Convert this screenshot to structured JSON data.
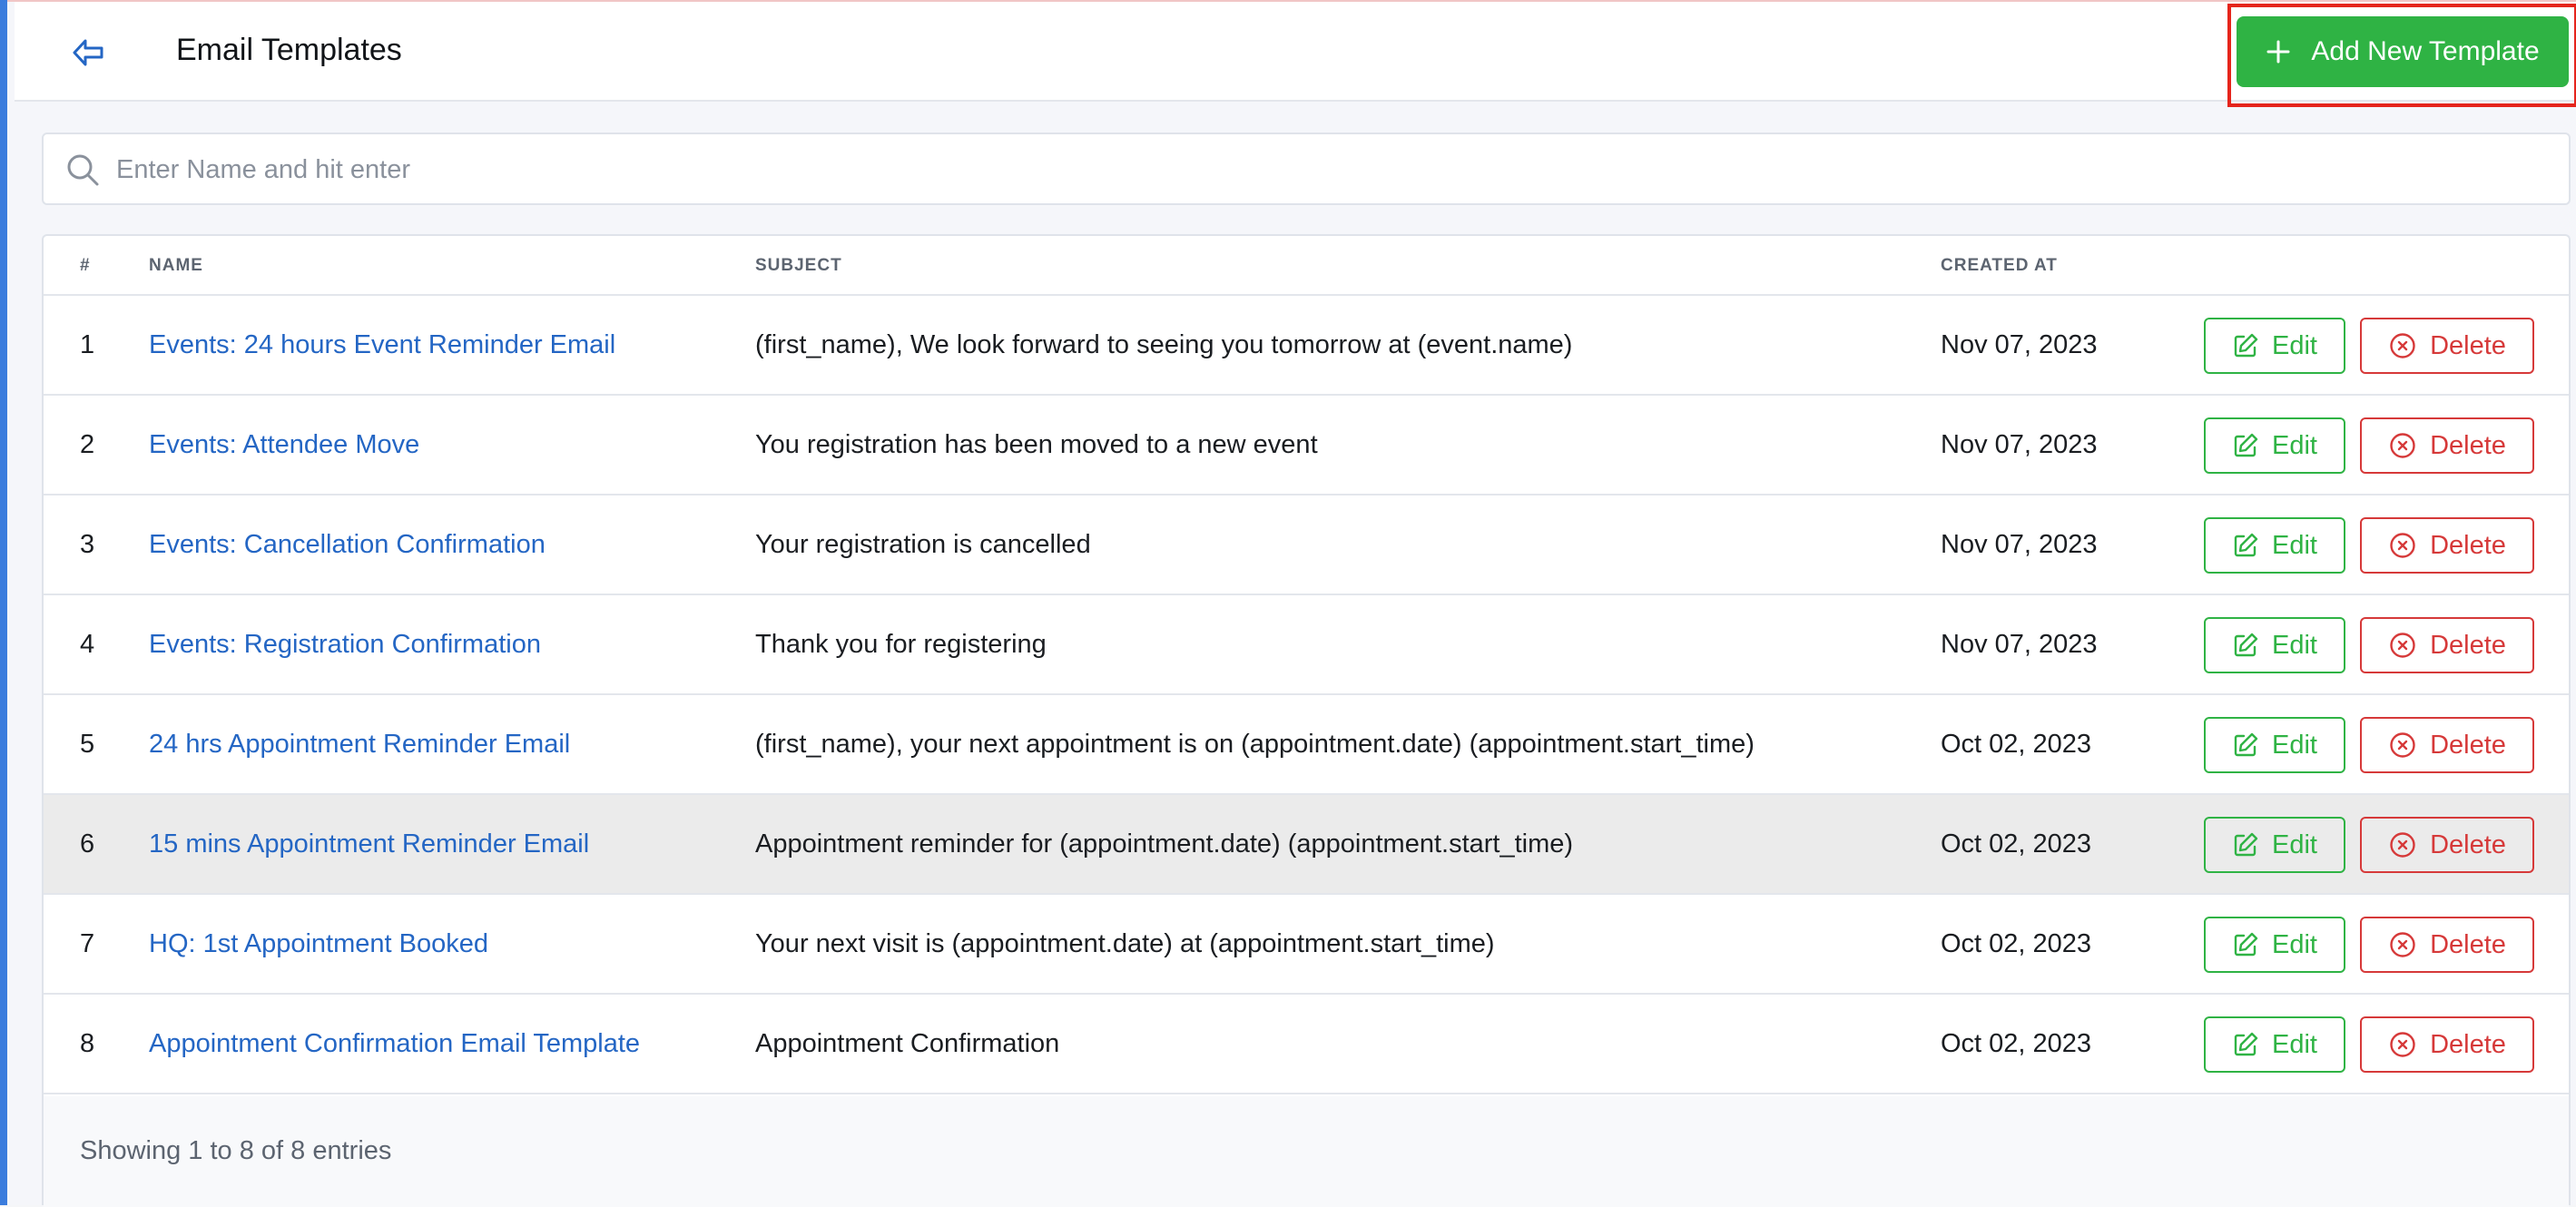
{
  "header": {
    "title": "Email Templates",
    "back_icon": "arrow-left-icon",
    "add_button_label": "Add New Template",
    "add_button_icon": "plus-icon"
  },
  "search": {
    "placeholder": "Enter Name and hit enter",
    "value": "",
    "icon": "search-icon"
  },
  "table": {
    "columns": {
      "num": "#",
      "name": "NAME",
      "subject": "SUBJECT",
      "created_at": "CREATED AT"
    },
    "edit_label": "Edit",
    "delete_label": "Delete",
    "rows": [
      {
        "num": "1",
        "name": "Events: 24 hours Event Reminder Email",
        "subject": "(first_name), We look forward to seeing you tomorrow at (event.name)",
        "created_at": "Nov 07, 2023"
      },
      {
        "num": "2",
        "name": "Events: Attendee Move",
        "subject": "You registration has been moved to a new event",
        "created_at": "Nov 07, 2023"
      },
      {
        "num": "3",
        "name": "Events: Cancellation Confirmation",
        "subject": "Your registration is cancelled",
        "created_at": "Nov 07, 2023"
      },
      {
        "num": "4",
        "name": "Events: Registration Confirmation",
        "subject": "Thank you for registering",
        "created_at": "Nov 07, 2023"
      },
      {
        "num": "5",
        "name": "24 hrs Appointment Reminder Email",
        "subject": "(first_name), your next appointment is on (appointment.date) (appointment.start_time)",
        "created_at": "Oct 02, 2023"
      },
      {
        "num": "6",
        "name": "15 mins Appointment Reminder Email",
        "subject": "Appointment reminder for (appointment.date) (appointment.start_time)",
        "created_at": "Oct 02, 2023"
      },
      {
        "num": "7",
        "name": "HQ: 1st Appointment Booked",
        "subject": "Your next visit is (appointment.date) at (appointment.start_time)",
        "created_at": "Oct 02, 2023"
      },
      {
        "num": "8",
        "name": "Appointment Confirmation Email Template",
        "subject": "Appointment Confirmation",
        "created_at": "Oct 02, 2023"
      }
    ]
  },
  "footer": {
    "entries_text": "Showing 1 to 8 of 8 entries"
  },
  "colors": {
    "accent_blue": "#3b7ddd",
    "link": "#2466c4",
    "success": "#2fb344",
    "danger": "#d63939",
    "highlight_box": "#e5251c"
  }
}
